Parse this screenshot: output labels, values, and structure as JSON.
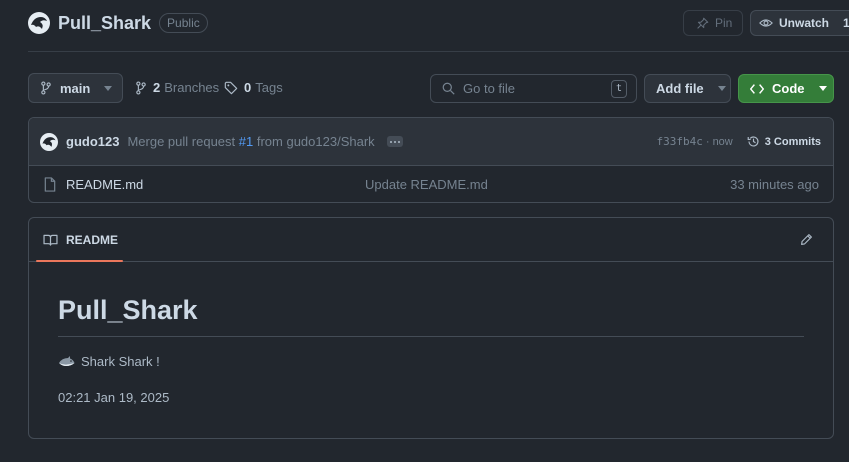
{
  "repo": {
    "name": "Pull_Shark",
    "visibility": "Public"
  },
  "actions": {
    "pin_label": "Pin",
    "watch_label": "Unwatch",
    "watch_count": "1"
  },
  "toolbar": {
    "branch": "main",
    "branches_count": "2",
    "branches_label": "Branches",
    "tags_count": "0",
    "tags_label": "Tags",
    "search_placeholder": "Go to file",
    "search_shortcut": "t",
    "add_file_label": "Add file",
    "code_label": "Code"
  },
  "commit": {
    "author": "gudo123",
    "message_prefix": "Merge pull request",
    "pr_ref": "#1",
    "message_suffix": "from gudo123/Shark",
    "sha": "f33fb4c",
    "separator": "·",
    "when": "now",
    "commits_label": "3 Commits"
  },
  "files": [
    {
      "name": "README.md",
      "message": "Update README.md",
      "age": "33 minutes ago"
    }
  ],
  "readme": {
    "tab_label": "README",
    "title": "Pull_Shark",
    "line1": "Shark Shark !",
    "line2": "02:21 Jan 19, 2025"
  },
  "colors": {
    "background": "#22272e",
    "accent_green": "#347d39",
    "link_blue": "#539bf5",
    "tab_underline": "#ec775c"
  }
}
